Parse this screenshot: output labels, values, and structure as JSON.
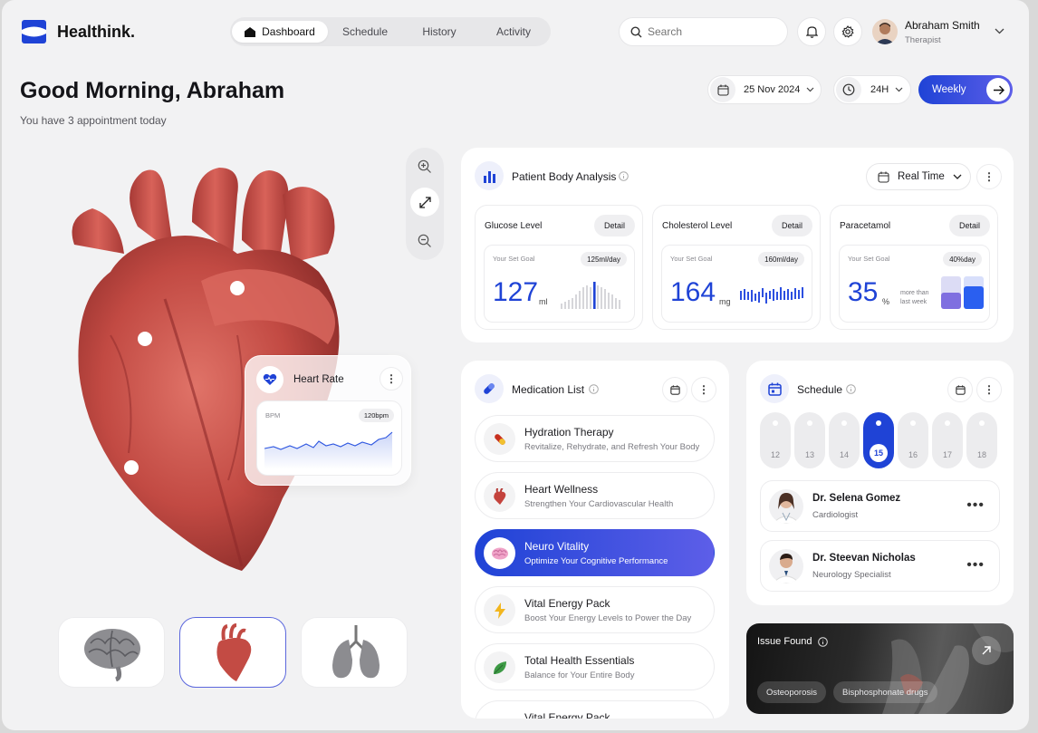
{
  "app": {
    "name": "Healthink."
  },
  "nav": {
    "tabs": [
      {
        "label": "Dashboard",
        "active": true
      },
      {
        "label": "Schedule",
        "active": false
      },
      {
        "label": "History",
        "active": false
      },
      {
        "label": "Activity",
        "active": false
      }
    ]
  },
  "search": {
    "placeholder": "Search"
  },
  "user": {
    "name": "Abraham Smith",
    "role": "Therapist"
  },
  "greeting": {
    "title": "Good Morning, Abraham",
    "subtitle": "You have 3 appointment today"
  },
  "filters": {
    "date": "25 Nov 2024",
    "range": "24H",
    "period": "Weekly"
  },
  "analysis": {
    "title": "Patient Body Analysis",
    "mode": "Real Time",
    "stats": [
      {
        "label": "Glucose Level",
        "detail": "Detail",
        "goal_label": "Your Set Goal",
        "goal": "125ml/day",
        "value": "127",
        "unit": "ml"
      },
      {
        "label": "Cholesterol Level",
        "detail": "Detail",
        "goal_label": "Your Set Goal",
        "goal": "160ml/day",
        "value": "164",
        "unit": "mg"
      },
      {
        "label": "Paracetamol",
        "detail": "Detail",
        "goal_label": "Your Set Goal",
        "goal": "40%day",
        "value": "35",
        "unit": "%",
        "note": "more than last week"
      }
    ]
  },
  "heart_rate": {
    "title": "Heart Rate",
    "label": "BPM",
    "value": "120bpm"
  },
  "medication": {
    "title": "Medication List",
    "items": [
      {
        "title": "Hydration Therapy",
        "subtitle": "Revitalize, Rehydrate, and Refresh Your Body",
        "icon": "pill-icon"
      },
      {
        "title": "Heart Wellness",
        "subtitle": "Strengthen Your Cardiovascular Health",
        "icon": "heart-icon"
      },
      {
        "title": "Neuro Vitality",
        "subtitle": "Optimize Your Cognitive Performance",
        "icon": "brain-icon",
        "active": true
      },
      {
        "title": "Vital Energy Pack",
        "subtitle": "Boost Your Energy Levels to Power the Day",
        "icon": "lightning-icon"
      },
      {
        "title": "Total Health Essentials",
        "subtitle": "Balance for Your Entire Body",
        "icon": "leaf-icon"
      },
      {
        "title": "Vital Energy Pack",
        "subtitle": "",
        "icon": "lightning-icon"
      }
    ]
  },
  "schedule": {
    "title": "Schedule",
    "days": [
      "12",
      "13",
      "14",
      "15",
      "16",
      "17",
      "18"
    ],
    "active_day": "15",
    "doctors": [
      {
        "name": "Dr. Selena Gomez",
        "role": "Cardiologist"
      },
      {
        "name": "Dr. Steevan Nicholas",
        "role": "Neurology Specialist"
      }
    ]
  },
  "issue": {
    "title": "Issue Found",
    "tags": [
      "Osteoporosis",
      "Bisphosphonate drugs"
    ]
  },
  "colors": {
    "accent": "#1f43d6",
    "heart": "#c0453f",
    "background": "#f2f2f3"
  }
}
